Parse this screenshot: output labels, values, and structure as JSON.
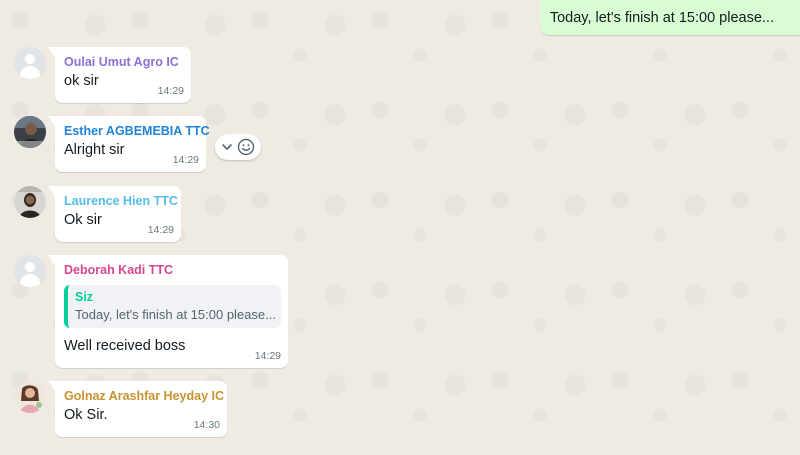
{
  "outgoing": {
    "text": "Today, let's finish at 15:00 please..."
  },
  "messages": [
    {
      "sender": "Oulai Umut Agro IC",
      "sender_color": "#8e6fd4",
      "text": "ok sir",
      "time": "14:29",
      "avatar": "default-avatar-icon"
    },
    {
      "sender": "Esther AGBEMEBIA TTC",
      "sender_color": "#1f83d8",
      "text": "Alright sir",
      "time": "14:29",
      "avatar": "profile-photo"
    },
    {
      "sender": "Laurence Hien TTC",
      "sender_color": "#53bdeb",
      "text": "Ok sir",
      "time": "14:29",
      "avatar": "profile-photo"
    },
    {
      "sender": "Deborah Kadi TTC",
      "sender_color": "#d9468e",
      "quote_author": "Siz",
      "quote_text": "Today, let's finish at 15:00 please...",
      "text": "Well received boss",
      "time": "14:29",
      "avatar": "default-avatar-icon"
    },
    {
      "sender": "Golnaz Arashfar Heyday IC",
      "sender_color": "#c7932f",
      "text": "Ok Sir.",
      "time": "14:30",
      "avatar": "profile-photo"
    }
  ],
  "hover_actions": {
    "icons": [
      "chevron-down-icon",
      "emoji-react-icon"
    ]
  }
}
